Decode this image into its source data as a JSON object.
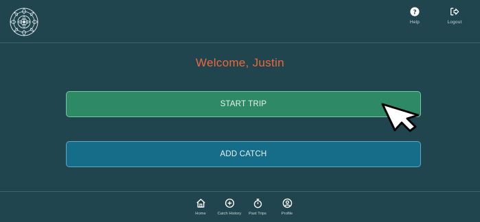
{
  "header": {
    "help_label": "Help",
    "logout_label": "Logout",
    "logo_icon": "mandala-logo-icon"
  },
  "main": {
    "welcome_text": "Welcome, Justin",
    "start_trip_label": "START TRIP",
    "add_catch_label": "ADD CATCH"
  },
  "nav": {
    "items": [
      {
        "label": "Home",
        "icon": "home-icon"
      },
      {
        "label": "Catch History",
        "icon": "plus-circle-icon"
      },
      {
        "label": "Past Trips",
        "icon": "stopwatch-icon"
      },
      {
        "label": "Profile",
        "icon": "user-circle-icon"
      }
    ]
  },
  "colors": {
    "background": "#21454e",
    "welcome": "#f0673a",
    "start_button": "#2e8a66",
    "catch_button": "#156d8a"
  }
}
